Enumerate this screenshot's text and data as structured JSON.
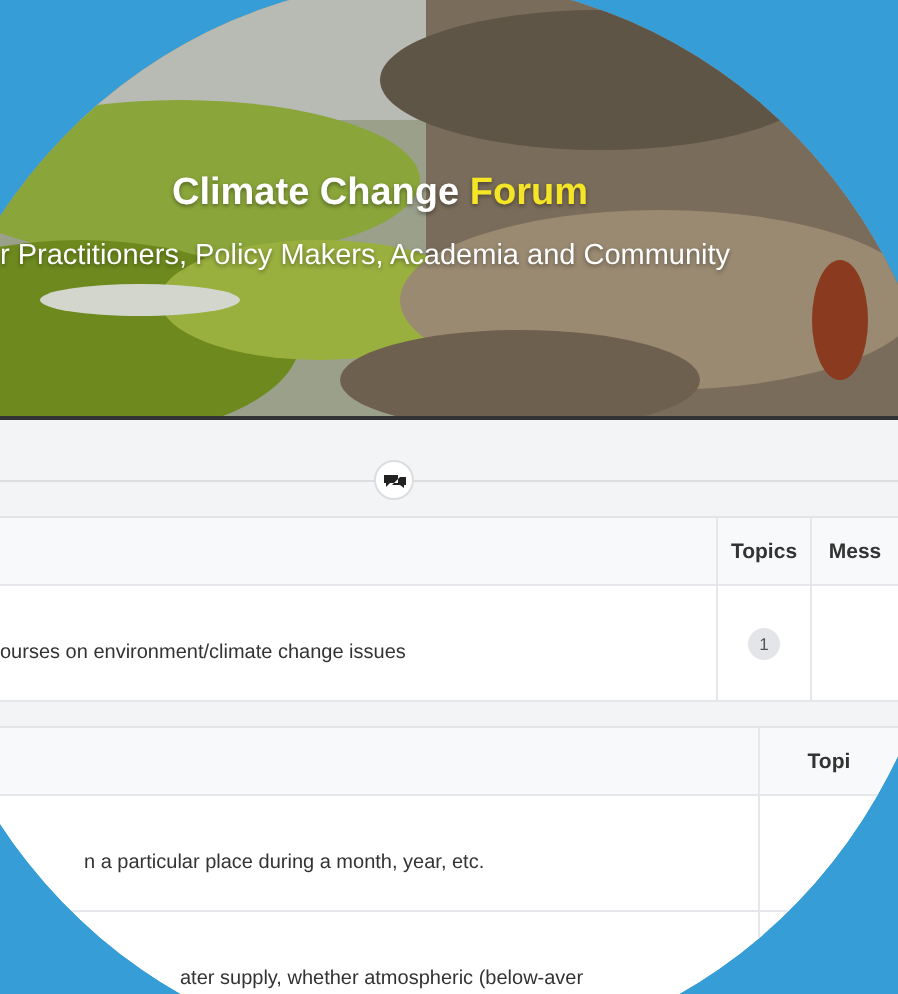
{
  "header": {
    "title": "Climate Change",
    "title_highlight": "Forum",
    "subtitle": "r Practitioners, Policy Makers, Academia and Community"
  },
  "tables": [
    {
      "columns": [
        "Topics",
        "Mess"
      ],
      "rows": [
        {
          "description": "ourses on environment/climate change issues",
          "topics": "1"
        }
      ]
    },
    {
      "columns": [
        "Topi"
      ],
      "rows": [
        {
          "description": "n a particular place during a month, year, etc."
        },
        {
          "description": "ater supply, whether atmospheric (below-aver"
        }
      ]
    }
  ]
}
